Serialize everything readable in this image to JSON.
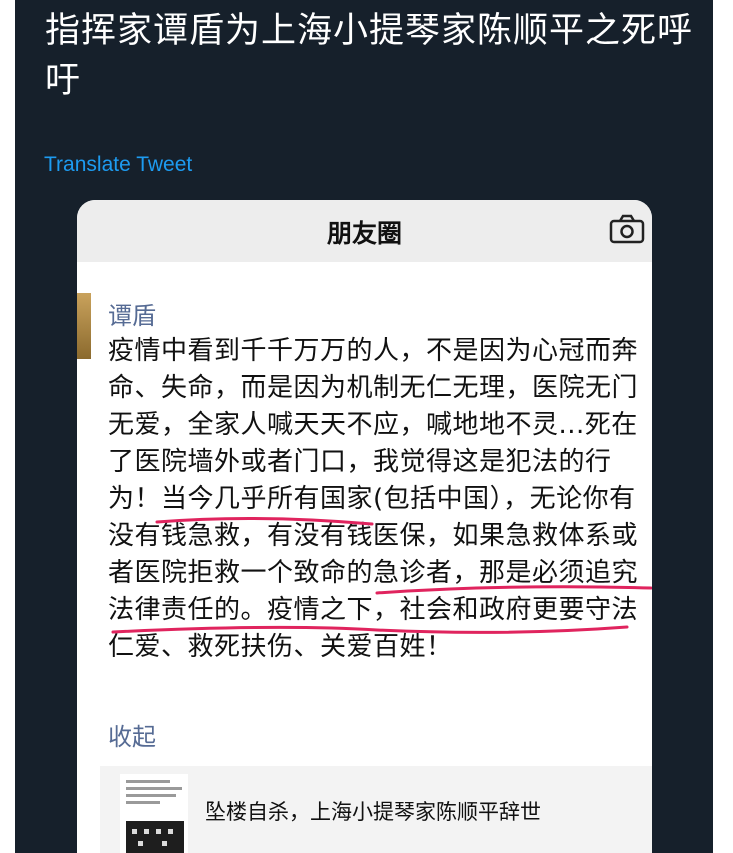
{
  "tweet": {
    "text": "指挥家谭盾为上海小提琴家陈顺平之死呼吁",
    "translate_label": "Translate Tweet"
  },
  "screenshot": {
    "header_title": "朋友圈",
    "post": {
      "author": "谭盾",
      "body": "疫情中看到千千万万的人，不是因为心冠而奔命、失命，而是因为机制无仁无理，医院无门无爱，全家人喊天天不应，喊地地不灵...死在了医院墙外或者门口，我觉得这是犯法的行为！当今几乎所有国家(包括中国），无论你有没有钱急救，有没有钱医保，如果急救体系或者医院拒救一个致命的急诊者，那是必须追究法律责任的。疫情之下，社会和政府更要守法仁爱、救死扶伤、关爱百姓！",
      "collapse_label": "收起"
    },
    "link_card": {
      "title": "坠楼自杀，上海小提琴家陈顺平辞世"
    }
  },
  "colors": {
    "dark_background": "#16202b",
    "link_blue": "#1d9bf0",
    "wechat_name_blue": "#566b94",
    "underline_red": "#e0245e"
  }
}
